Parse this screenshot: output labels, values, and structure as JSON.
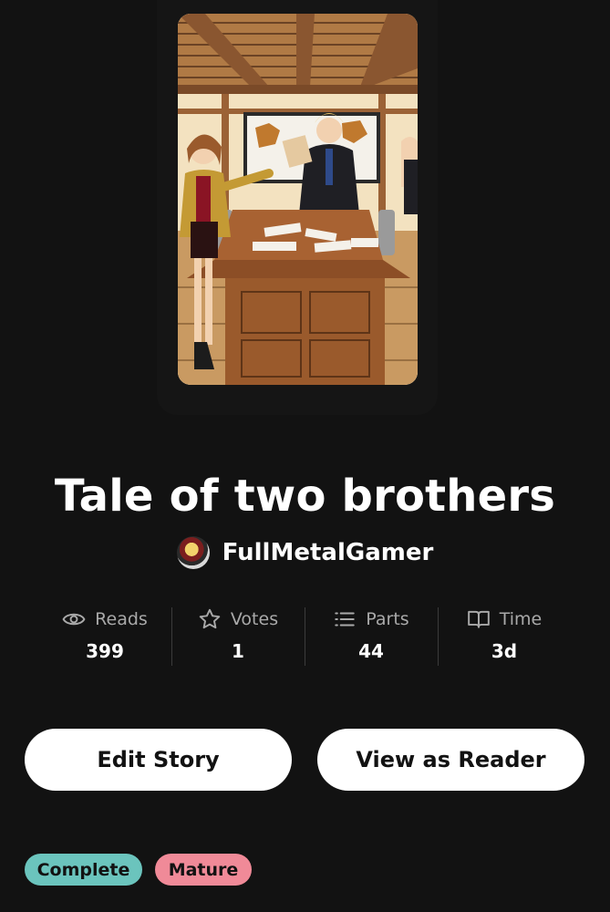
{
  "story": {
    "title": "Tale of two brothers",
    "author": "FullMetalGamer"
  },
  "stats": [
    {
      "label": "Reads",
      "value": "399",
      "icon": "eye-icon"
    },
    {
      "label": "Votes",
      "value": "1",
      "icon": "star-icon"
    },
    {
      "label": "Parts",
      "value": "44",
      "icon": "list-icon"
    },
    {
      "label": "Time",
      "value": "3d",
      "icon": "book-open-icon"
    }
  ],
  "buttons": {
    "edit": "Edit Story",
    "view": "View as Reader"
  },
  "tags": {
    "complete": "Complete",
    "mature": "Mature"
  },
  "colors": {
    "background": "#121212",
    "complete_tag": "#6bc4bd",
    "mature_tag": "#f08a98"
  }
}
